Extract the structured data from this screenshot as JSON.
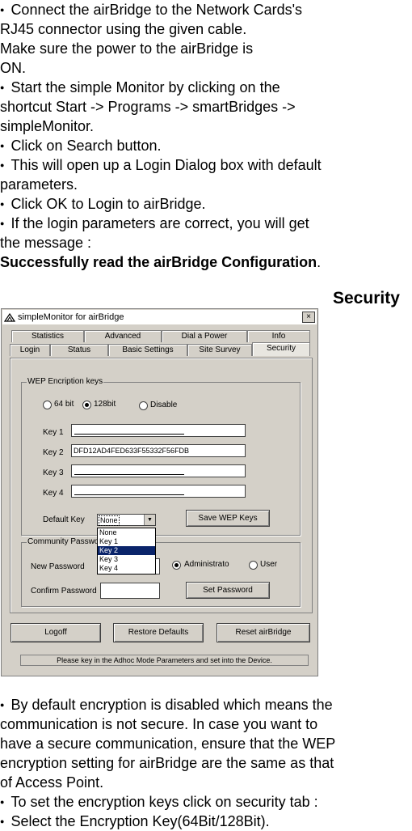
{
  "intro": {
    "b1": "Connect the airBridge to the Network Cards's",
    "b1_l2": "RJ45 connector using the given cable.",
    "b1_l3": "Make sure the power to the airBridge is",
    "b1_l4": "ON.",
    "b2": "Start the simple Monitor by clicking on the",
    "b2_l2": "shortcut Start -> Programs -> smartBridges ->",
    "b2_l3": "simpleMonitor.",
    "b3": "Click on Search button.",
    "b4": "This will open up a Login Dialog box with default",
    "b4_l2": "parameters.",
    "b5": "Click OK to Login to airBridge.",
    "b6": "If the login parameters are correct, you will get",
    "b6_l2": "the message :",
    "success": "Successfully read the airBridge Configuration",
    "period": "."
  },
  "section_heading": "Security",
  "window": {
    "title": "simpleMonitor for airBridge",
    "close": "×",
    "tabs_row1": [
      "Statistics",
      "Advanced",
      "Dial a Power",
      "Info"
    ],
    "tabs_row2": [
      "Login",
      "Status",
      "Basic Settings",
      "Site Survey",
      "Security"
    ],
    "wep": {
      "legend": "WEP Encription keys",
      "opt64": "64 bit",
      "opt128": "128bit",
      "optDisable": "Disable",
      "key1_label": "Key 1",
      "key2_label": "Key 2",
      "key3_label": "Key 3",
      "key4_label": "Key 4",
      "key2_value": "DFD12AD4FED633F55332F56FDB",
      "default_key_label": "Default Key",
      "default_key_value": "None",
      "dropdown_options": [
        "None",
        "Key 1",
        "Key 2",
        "Key 3",
        "Key 4"
      ],
      "save_button": "Save WEP Keys"
    },
    "community": {
      "legend": "Community Passwor",
      "new_password_label": "New Password",
      "confirm_password_label": "Confirm Password",
      "admin": "Administrator",
      "user": "User",
      "set_button": "Set Password"
    },
    "bottom": {
      "logoff": "Logoff",
      "restore": "Restore Defaults",
      "reset": "Reset airBridge"
    },
    "status": "Please key in the Adhoc Mode Parameters and set into the Device."
  },
  "outro": {
    "b1": "By default encryption is disabled which means the",
    "b1_l2": "communication is not secure. In case you want to",
    "b1_l3": "have a secure communication, ensure that the WEP",
    "b1_l4": "encryption setting for airBridge are the same as that",
    "b1_l5": "of Access Point.",
    "b2": "To set the encryption keys click on security tab :",
    "b3": "Select the Encryption Key(64Bit/128Bit)."
  }
}
